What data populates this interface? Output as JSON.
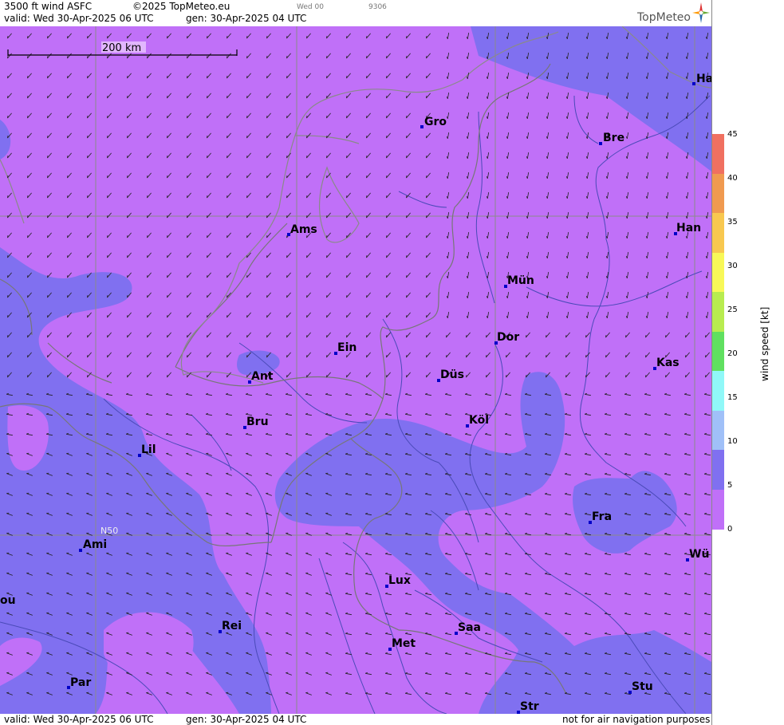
{
  "header": {
    "title": "3500 ft wind ASFC",
    "copyright": "©2025 TopMeteo.eu",
    "valid": "valid:  Wed  30-Apr-2025  06 UTC",
    "generated": "gen: 30-Apr-2025 04 UTC",
    "small_day": "Wed 00",
    "small_code": "9306",
    "logo": "TopMeteo"
  },
  "footer": {
    "valid": "valid:  Wed  30-Apr-2025  06 UTC",
    "generated": "gen: 30-Apr-2025 04 UTC",
    "disclaimer": "not for air navigation purposes"
  },
  "scale_bar": {
    "label": "200 km"
  },
  "grid_label": "N50",
  "legend": {
    "unit": "wind  speed  [kt]",
    "ticks": [
      "45",
      "40",
      "35",
      "30",
      "25",
      "20",
      "15",
      "10",
      "5",
      "0"
    ],
    "colors": [
      "#f07060",
      "#f09a50",
      "#f8c850",
      "#f8f858",
      "#b8ec50",
      "#60e060",
      "#90f8f8",
      "#a0c0f8",
      "#8070f0",
      "#c070f8"
    ]
  },
  "cities": [
    {
      "id": "ha",
      "name": "Ha"
    },
    {
      "id": "gro",
      "name": "Gro"
    },
    {
      "id": "bre",
      "name": "Bre"
    },
    {
      "id": "ams",
      "name": "Ams"
    },
    {
      "id": "han",
      "name": "Han"
    },
    {
      "id": "mun",
      "name": "Mün"
    },
    {
      "id": "dor",
      "name": "Dor"
    },
    {
      "id": "ein",
      "name": "Ein"
    },
    {
      "id": "kas",
      "name": "Kas"
    },
    {
      "id": "ant",
      "name": "Ant"
    },
    {
      "id": "dus",
      "name": "Düs"
    },
    {
      "id": "bru",
      "name": "Bru"
    },
    {
      "id": "kol",
      "name": "Köl"
    },
    {
      "id": "lil",
      "name": "Lil"
    },
    {
      "id": "fra",
      "name": "Fra"
    },
    {
      "id": "ami",
      "name": "Ami"
    },
    {
      "id": "wu",
      "name": "Wü"
    },
    {
      "id": "lux",
      "name": "Lux"
    },
    {
      "id": "rei",
      "name": "Rei"
    },
    {
      "id": "saa",
      "name": "Saa"
    },
    {
      "id": "met",
      "name": "Met"
    },
    {
      "id": "par",
      "name": "Par"
    },
    {
      "id": "stu",
      "name": "Stu"
    },
    {
      "id": "str",
      "name": "Str"
    },
    {
      "id": "ou",
      "name": "ou"
    }
  ]
}
